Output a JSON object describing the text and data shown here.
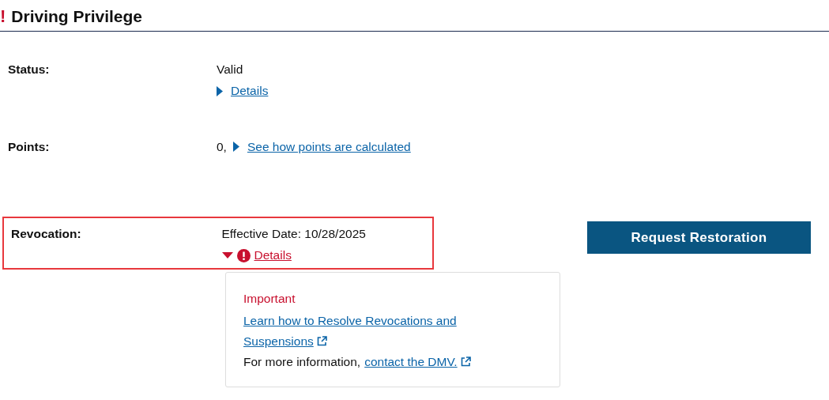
{
  "header": {
    "alert_mark": "!",
    "title": "Driving Privilege"
  },
  "rows": [
    {
      "label": "Status:",
      "value": "Valid",
      "kind": "stacked",
      "highlighted": false,
      "link": {
        "text": "Details",
        "expanded": false,
        "alert": false
      }
    },
    {
      "label": "Points:",
      "value": "0,",
      "kind": "inline",
      "highlighted": false,
      "link": {
        "text": "See how points are calculated",
        "expanded": false,
        "alert": false
      }
    },
    {
      "label": "Revocation:",
      "value": "Effective Date: 10/28/2025",
      "kind": "stacked",
      "highlighted": true,
      "link": {
        "text": "Details",
        "expanded": true,
        "alert": true
      },
      "panel": {
        "heading": "Important",
        "link": "Learn how to Resolve Revocations and Suspensions",
        "note": "For more information,",
        "note_link": "contact the DMV."
      },
      "button": "Request Restoration"
    }
  ]
}
